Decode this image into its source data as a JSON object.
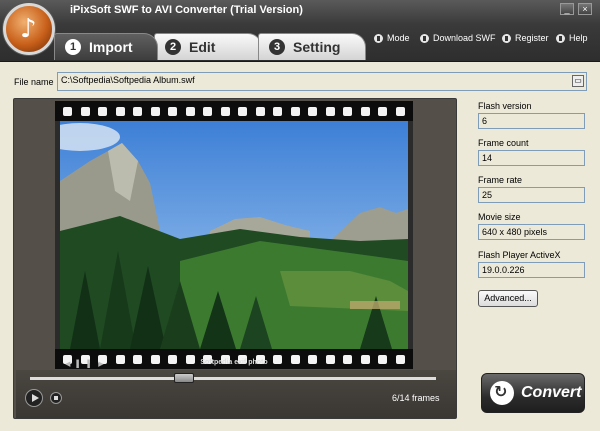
{
  "window": {
    "title": "iPixSoft SWF to AVI Converter (Trial Version)",
    "minimize_icon": "minimize-icon",
    "close_icon": "close-icon"
  },
  "tabs": [
    {
      "number": "1",
      "label": "Import",
      "active": true
    },
    {
      "number": "2",
      "label": "Edit",
      "active": false
    },
    {
      "number": "3",
      "label": "Setting",
      "active": false
    }
  ],
  "toplinks": [
    {
      "label": "Mode",
      "icon": "mode-icon"
    },
    {
      "label": "Download SWF",
      "icon": "download-icon"
    },
    {
      "label": "Register",
      "icon": "register-icon"
    },
    {
      "label": "Help",
      "icon": "help-icon"
    }
  ],
  "file": {
    "label": "File name",
    "value": "C:\\Softpedia\\Softpedia Album.swf"
  },
  "player": {
    "caption": "Softpedia exif photo",
    "frame_status": "6/14 frames",
    "progress": 0.38
  },
  "info": {
    "flash_version": {
      "label": "Flash version",
      "value": "6"
    },
    "frame_count": {
      "label": "Frame count",
      "value": "14"
    },
    "frame_rate": {
      "label": "Frame rate",
      "value": "25"
    },
    "movie_size": {
      "label": "Movie size",
      "value": "640 x 480 pixels"
    },
    "flash_player": {
      "label": "Flash Player ActiveX",
      "value": "19.0.0.226"
    }
  },
  "buttons": {
    "advanced": "Advanced...",
    "convert": "Convert"
  }
}
